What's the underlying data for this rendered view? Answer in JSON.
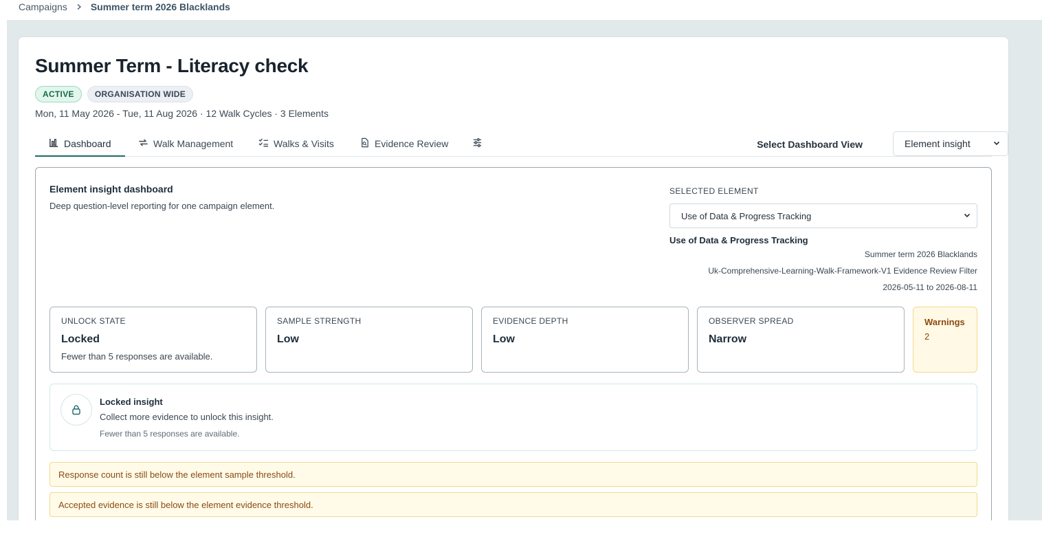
{
  "breadcrumb": {
    "parent": "Campaigns",
    "current": "Summer term 2026 Blacklands"
  },
  "campaign": {
    "title": "Summer Term - Literacy check",
    "status_badge": "ACTIVE",
    "scope_badge": "ORGANISATION WIDE",
    "meta": "Mon, 11 May 2026 - Tue, 11 Aug 2026 · 12 Walk Cycles · 3 Elements"
  },
  "tabs": [
    {
      "label": "Dashboard",
      "icon": "bar-chart-icon",
      "active": true
    },
    {
      "label": "Walk Management",
      "icon": "repeat-arrows-icon",
      "active": false
    },
    {
      "label": "Walks & Visits",
      "icon": "checklist-icon",
      "active": false
    },
    {
      "label": "Evidence Review",
      "icon": "file-search-icon",
      "active": false
    },
    {
      "label": "",
      "icon": "sliders-icon",
      "active": false
    }
  ],
  "view_selector": {
    "label": "Select Dashboard View",
    "value": "Element insight"
  },
  "insight": {
    "title": "Element insight dashboard",
    "subtitle": "Deep question-level reporting for one campaign element.",
    "selected_element_label": "SELECTED ELEMENT",
    "selected_element_value": "Use of Data & Progress Tracking",
    "element_name": "Use of Data & Progress Tracking",
    "campaign_name": "Summer term 2026 Blacklands",
    "framework_line": "Uk-Comprehensive-Learning-Walk-Framework-V1  Evidence Review Filter",
    "date_range": "2026-05-11 to 2026-08-11"
  },
  "stats": [
    {
      "label": "UNLOCK STATE",
      "value": "Locked",
      "note": "Fewer than 5 responses are available."
    },
    {
      "label": "SAMPLE STRENGTH",
      "value": "Low",
      "note": ""
    },
    {
      "label": "EVIDENCE DEPTH",
      "value": "Low",
      "note": ""
    },
    {
      "label": "OBSERVER SPREAD",
      "value": "Narrow",
      "note": ""
    }
  ],
  "warnings": {
    "title": "Warnings",
    "count": "2"
  },
  "locked_insight": {
    "title": "Locked insight",
    "subtitle": "Collect more evidence to unlock this insight.",
    "note": "Fewer than 5 responses are available."
  },
  "alerts": [
    "Response count is still below the element sample threshold.",
    "Accepted evidence is still below the element evidence threshold."
  ],
  "colors": {
    "accent": "#1e6a6a",
    "active_badge": "#166a48",
    "warning_text": "#8a4a12",
    "warning_bg": "#fffbe8",
    "canvas_bg": "#e1e9ea"
  }
}
